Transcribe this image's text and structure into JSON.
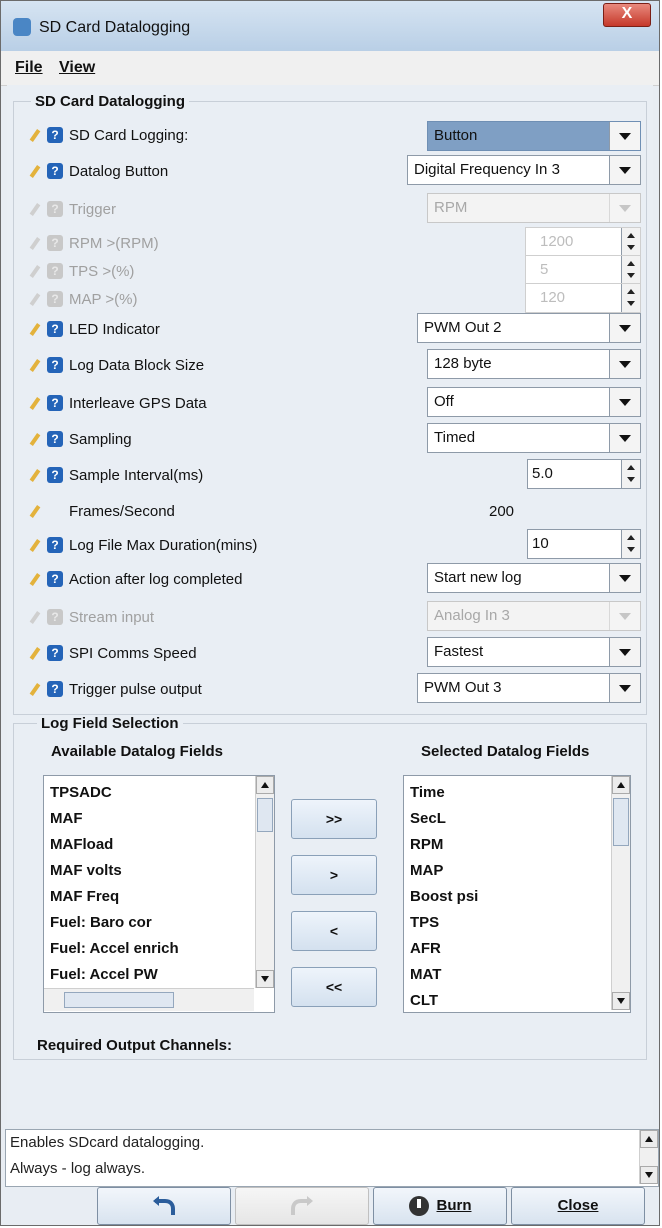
{
  "window": {
    "title": "SD Card Datalogging",
    "close": "X"
  },
  "menu": {
    "file": "File",
    "view": "View"
  },
  "section1": {
    "title": "SD Card Datalogging",
    "rows": [
      {
        "label": "SD Card Logging:",
        "value": "Button",
        "enabled": true
      },
      {
        "label": "Datalog Button",
        "value": "Digital Frequency In 3",
        "enabled": true
      },
      {
        "label": "Trigger",
        "value": "RPM",
        "enabled": false
      },
      {
        "label": "RPM >(RPM)",
        "value": "1200",
        "enabled": false
      },
      {
        "label": "TPS >(%)",
        "value": "5",
        "enabled": false
      },
      {
        "label": "MAP >(%)",
        "value": "120",
        "enabled": false
      },
      {
        "label": "LED Indicator",
        "value": "PWM Out 2",
        "enabled": true
      },
      {
        "label": "Log Data Block Size",
        "value": "128 byte",
        "enabled": true
      },
      {
        "label": "Interleave GPS Data",
        "value": "Off",
        "enabled": true
      },
      {
        "label": "Sampling",
        "value": "Timed",
        "enabled": true
      },
      {
        "label": "Sample Interval(ms)",
        "value": "5.0",
        "enabled": true
      },
      {
        "label": "Frames/Second",
        "value": "200",
        "enabled": true
      },
      {
        "label": "Log File Max Duration(mins)",
        "value": "10",
        "enabled": true
      },
      {
        "label": "Action after log completed",
        "value": "Start new log",
        "enabled": true
      },
      {
        "label": "Stream input",
        "value": "Analog In 3",
        "enabled": false
      },
      {
        "label": "SPI Comms Speed",
        "value": "Fastest",
        "enabled": true
      },
      {
        "label": "Trigger pulse output",
        "value": "PWM Out 3",
        "enabled": true
      }
    ]
  },
  "section2": {
    "title": "Log Field Selection",
    "available_title": "Available Datalog Fields",
    "selected_title": "Selected Datalog Fields",
    "available": [
      "TPSADC",
      "MAF",
      "MAFload",
      "MAF volts",
      "MAF Freq",
      "Fuel: Baro cor",
      "Fuel: Accel enrich",
      "Fuel: Accel PW"
    ],
    "selected": [
      "Time",
      "SecL",
      "RPM",
      "MAP",
      "Boost psi",
      "TPS",
      "AFR",
      "MAT",
      "CLT"
    ],
    "buttons": [
      ">>",
      ">",
      "<",
      "<<"
    ],
    "required_label": "Required Output Channels:"
  },
  "description": {
    "line1": "Enables SDcard datalogging.",
    "line2": "Always - log always."
  },
  "footer": {
    "burn": "Burn",
    "close": "Close"
  }
}
